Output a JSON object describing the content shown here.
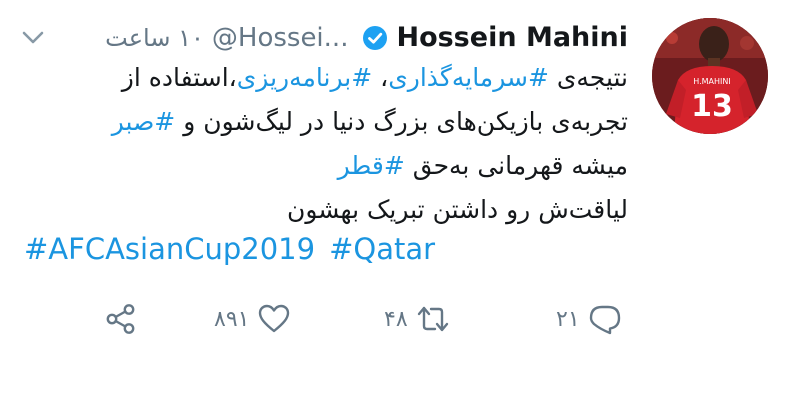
{
  "author": {
    "name": "Hossein Mahini",
    "handle": "@Hossei...",
    "time": "۱۰ ساعت",
    "jersey_name": "H.MAHINI",
    "jersey_number": "13"
  },
  "tweet": {
    "lines": [
      [
        {
          "text": "نتیجه‌ی ",
          "tag": false
        },
        {
          "text": "#سرمایه‌گذاری",
          "tag": true
        },
        {
          "text": "، ",
          "tag": false
        },
        {
          "text": "#برنامه‌ریزی",
          "tag": true
        },
        {
          "text": "،استفاده از",
          "tag": false
        }
      ],
      [
        {
          "text": "تجربه‌ی بازیکن‌های بزرگ دنیا در لیگ‌شون و ",
          "tag": false
        },
        {
          "text": "#صبر",
          "tag": true
        }
      ],
      [
        {
          "text": "میشه قهرمانی به‌حق ",
          "tag": false
        },
        {
          "text": "#قطر",
          "tag": true
        }
      ],
      [
        {
          "text": "لیاقت‌ش رو داشتن تبریک بهشون",
          "tag": false
        }
      ]
    ],
    "hashtags": [
      "#AFCAsianCup2019",
      "#Qatar"
    ]
  },
  "actions": {
    "replies": "۲۱",
    "retweets": "۴۸",
    "likes": "۸۹۱"
  },
  "colors": {
    "link": "#1b95e0",
    "muted": "#657786",
    "verified": "#1da1f2"
  }
}
